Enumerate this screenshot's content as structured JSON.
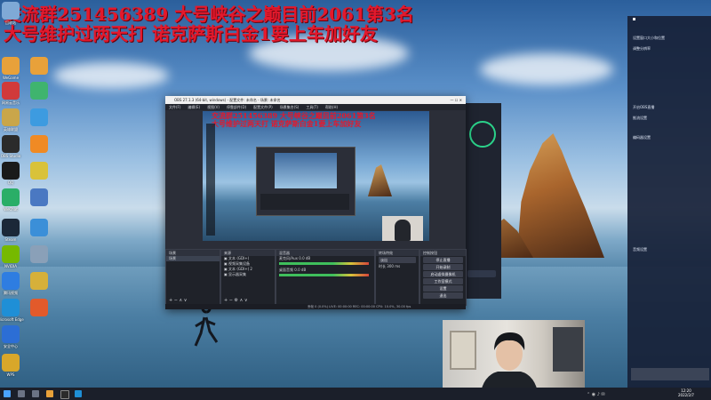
{
  "overlay": {
    "line1": "交流群251456389 大号峡谷之巅目前2061第3名",
    "line2": "大号维护过两天打 诺克萨斯白金1要上车加好友"
  },
  "obs": {
    "title": "OBS 27.1.3 (64-bit, windows) - 配置文件: 未命名 - 场景: 未命名",
    "window_controls": "—  ☐  ✕",
    "menu": [
      "文件(F)",
      "编辑(E)",
      "视图(V)",
      "停靠部件(D)",
      "配置文件(P)",
      "场景集合(S)",
      "工具(T)",
      "帮助(H)"
    ],
    "scenes_label": "场景",
    "scene_item": "场景",
    "sources_label": "来源",
    "sources": [
      "文本 (GDI+)",
      "视频采集设备",
      "文本 (GDI+) 2",
      "显示器采集"
    ],
    "mixer_label": "混音器",
    "mixer": [
      {
        "name": "麦克风/Aux",
        "db": "0.0 dB"
      },
      {
        "name": "桌面音频",
        "db": "0.0 dB"
      }
    ],
    "transition_label": "转场特效",
    "transition": {
      "type": "淡出",
      "duration_label": "时长",
      "duration": "300 ms"
    },
    "controls_label": "控制按钮",
    "controls": [
      "停止直播",
      "开始录制",
      "启动虚拟摄像机",
      "工作室模式",
      "设置",
      "退出"
    ],
    "status_text": "丢帧 0 (0.0%)   LIVE: 00:00:00   REC: 00:00:00   CPU: 10.0%, 30.00 fps"
  },
  "icons": [
    {
      "label": "回收站",
      "icon": "recycle-bin-icon",
      "color": "#7fa9d6"
    },
    {
      "label": "WeGame",
      "icon": "wegame-icon",
      "color": "#e8a13a"
    },
    {
      "label": "网易云音乐",
      "icon": "music-icon",
      "color": "#d13a3a"
    },
    {
      "label": "英雄联盟",
      "icon": "lol-icon",
      "color": "#c9a64a"
    },
    {
      "label": "OBS Studio",
      "icon": "obs-icon",
      "color": "#2b2b2b"
    },
    {
      "label": "QQ",
      "icon": "qq-icon",
      "color": "#1a1a1a"
    },
    {
      "label": "WeChat",
      "icon": "wechat-icon",
      "color": "#2aae67"
    },
    {
      "label": "Steam",
      "icon": "steam-icon",
      "color": "#1b2838"
    },
    {
      "label": "NVIDIA",
      "icon": "nvidia-icon",
      "color": "#76b900"
    },
    {
      "label": "腾讯视频",
      "icon": "video-icon",
      "color": "#2e7de1"
    },
    {
      "label": "Microsoft Edge",
      "icon": "edge-icon",
      "color": "#1f8fd6"
    },
    {
      "label": "安全中心",
      "icon": "shield-icon",
      "color": "#2c6ed5"
    },
    {
      "label": "WPS",
      "icon": "wps-icon",
      "color": "#d8a72a"
    }
  ],
  "notifications": [
    "设置窗口大小和位置",
    "调整分辨率",
    "开启OBS直播",
    "推流设置",
    "编码器设置",
    "音频设置"
  ],
  "taskbar": {
    "time": "12:20",
    "date": "2022/2/7"
  },
  "colors": {
    "overlay": "#e3192c",
    "obs_bg": "#2b2e38",
    "taskbar": "#1b1f2a"
  }
}
